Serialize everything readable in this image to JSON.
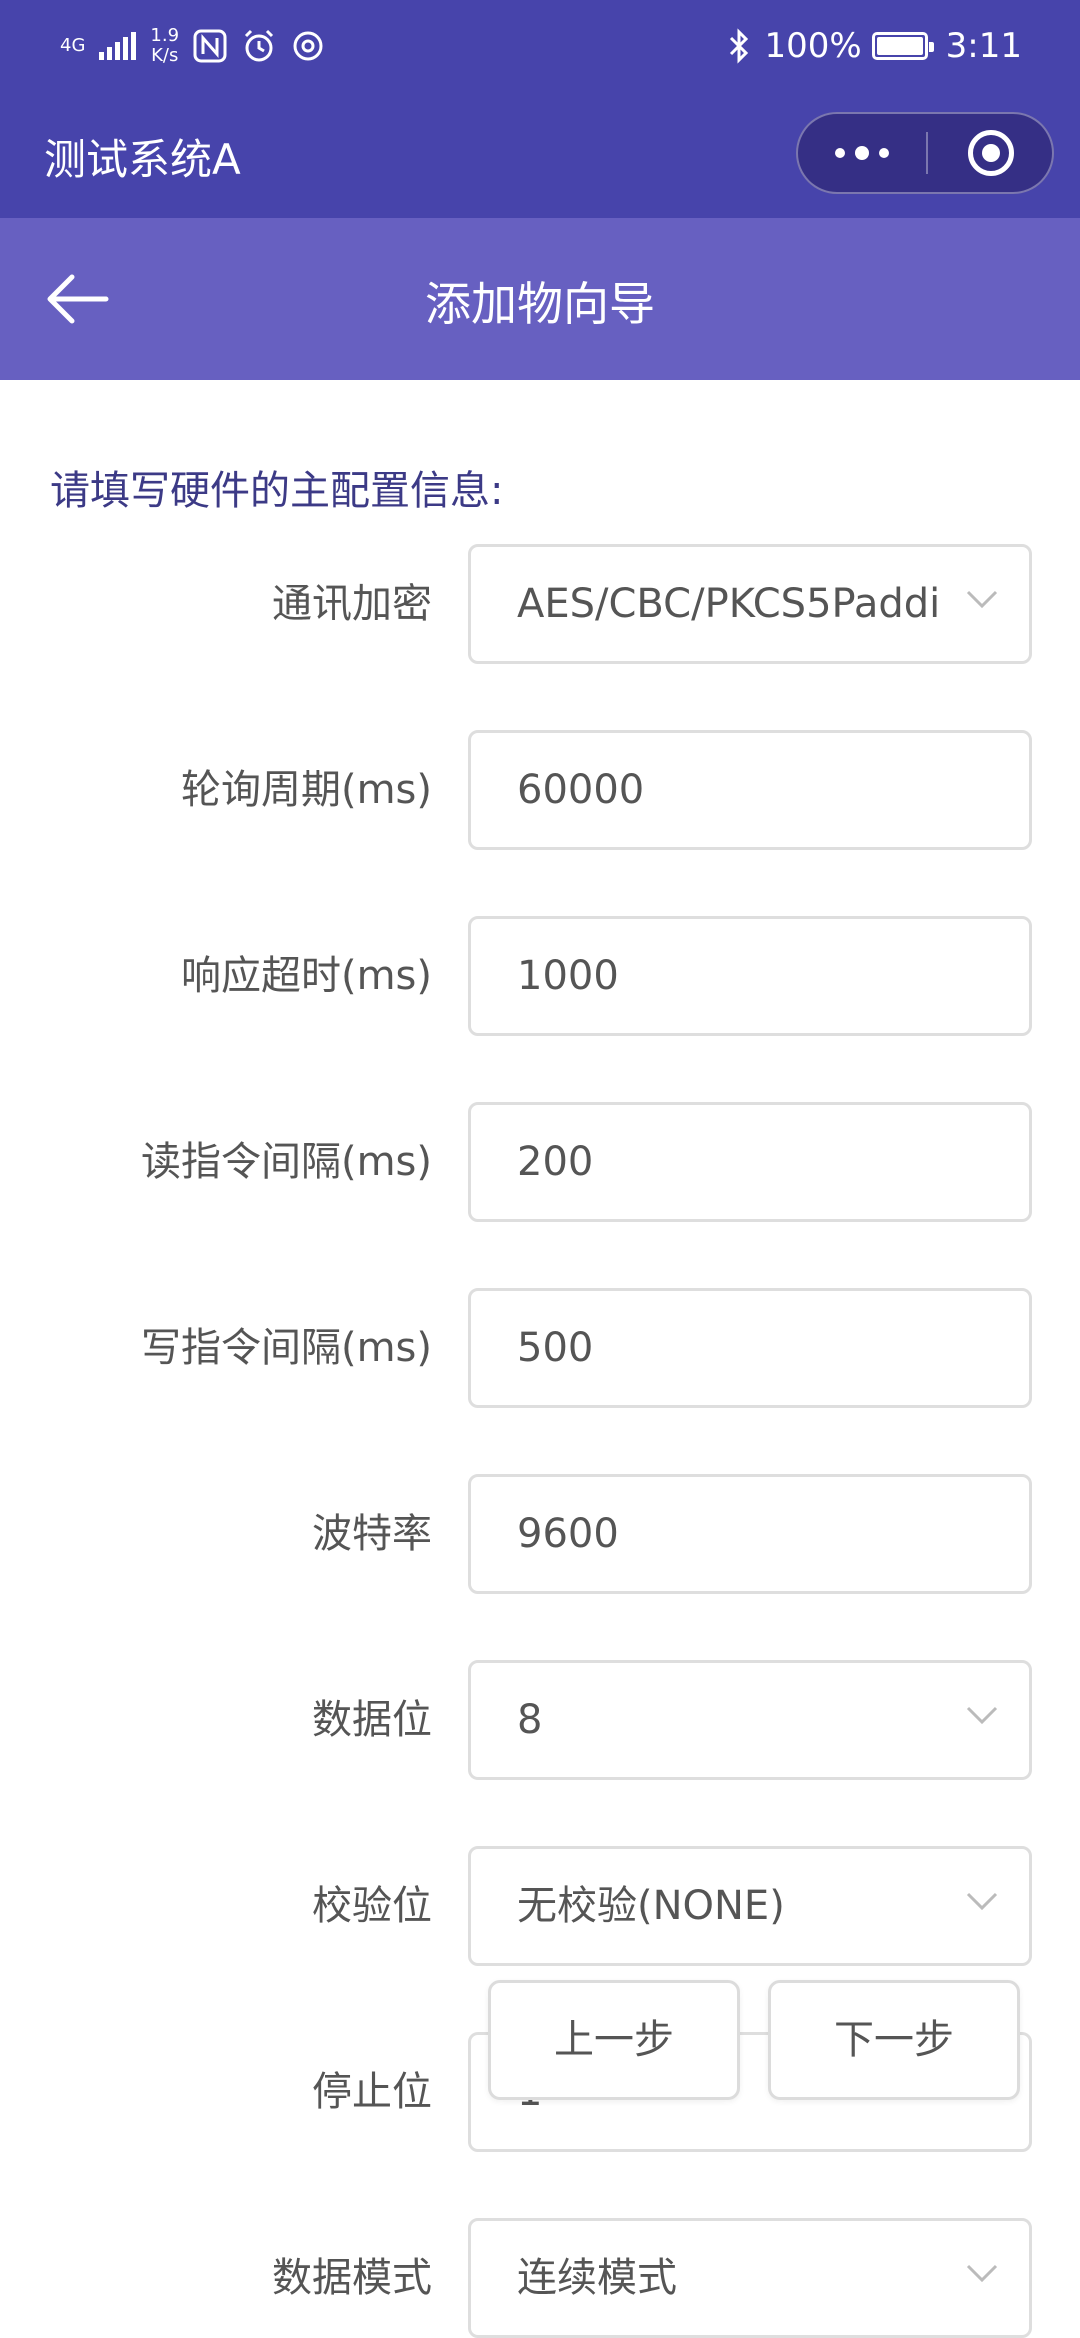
{
  "status_bar": {
    "network": "4G",
    "speed_value": "1.9",
    "speed_unit": "K/s",
    "battery_text": "100%",
    "time": "3:11",
    "icons": [
      "signal-icon",
      "nfc-icon",
      "alarm-icon",
      "data-saver-icon",
      "bluetooth-icon",
      "battery-icon"
    ]
  },
  "app": {
    "title": "测试系统A",
    "more_icon": "more-dots-icon",
    "close_icon": "target-close-icon"
  },
  "page": {
    "back_icon": "arrow-left-icon",
    "title": "添加物向导"
  },
  "form": {
    "intro": "请填写硬件的主配置信息:",
    "fields": [
      {
        "label": "通讯加密",
        "value": "AES/CBC/PKCS5Paddi",
        "type": "select"
      },
      {
        "label": "轮询周期(ms)",
        "value": "60000",
        "type": "input"
      },
      {
        "label": "响应超时(ms)",
        "value": "1000",
        "type": "input"
      },
      {
        "label": "读指令间隔(ms)",
        "value": "200",
        "type": "input"
      },
      {
        "label": "写指令间隔(ms)",
        "value": "500",
        "type": "input"
      },
      {
        "label": "波特率",
        "value": "9600",
        "type": "input"
      },
      {
        "label": "数据位",
        "value": "8",
        "type": "select"
      },
      {
        "label": "校验位",
        "value": "无校验(NONE)",
        "type": "select"
      },
      {
        "label": "停止位",
        "value": "1",
        "type": "input"
      },
      {
        "label": "数据模式",
        "value": "连续模式",
        "type": "select"
      }
    ]
  },
  "buttons": {
    "prev": "上一步",
    "next": "下一步"
  },
  "colors": {
    "header": "#4744ab",
    "subheader": "#6760c1",
    "intro_text": "#3c3a86"
  }
}
